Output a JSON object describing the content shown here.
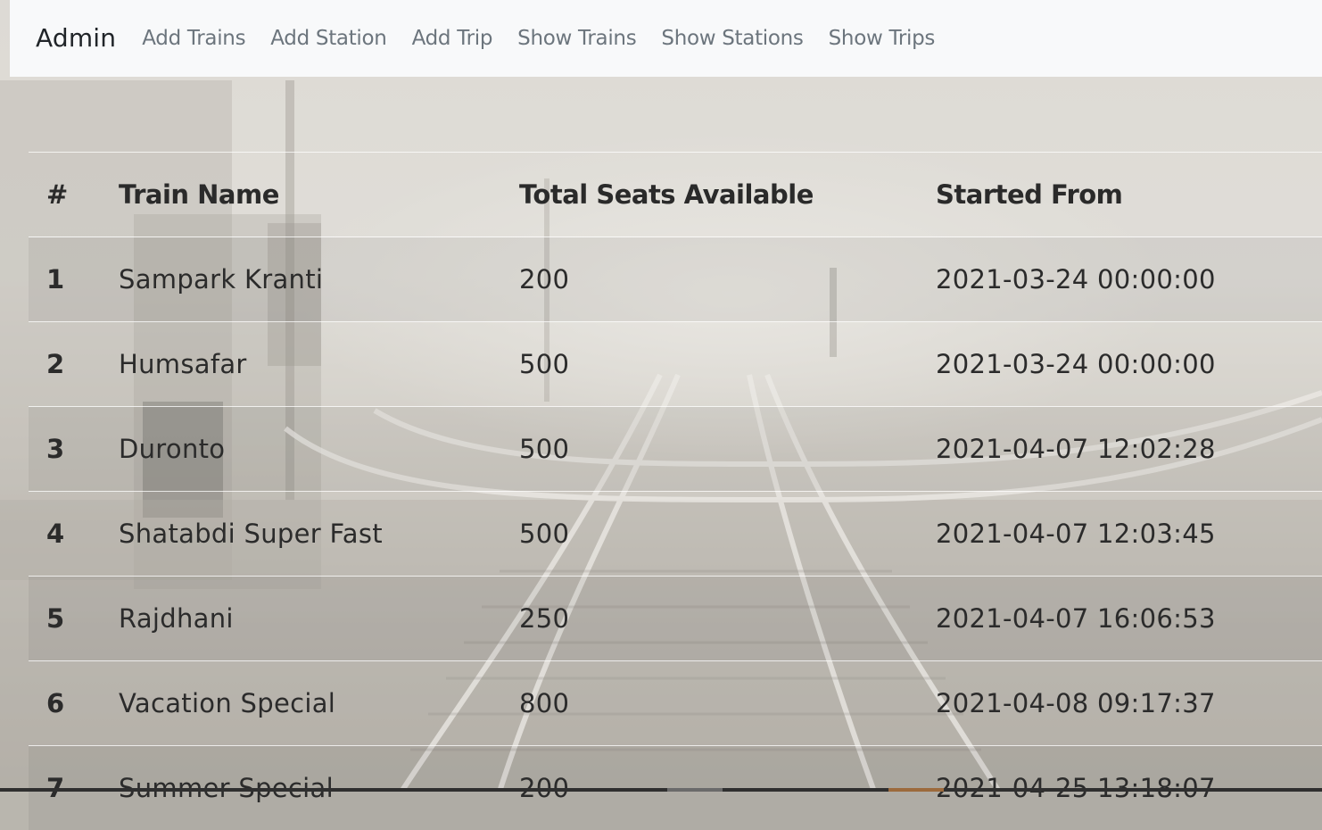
{
  "navbar": {
    "brand": "Admin",
    "links": [
      "Add Trains",
      "Add Station",
      "Add Trip",
      "Show Trains",
      "Show Stations",
      "Show Trips"
    ]
  },
  "table": {
    "headers": [
      "#",
      "Train Name",
      "Total Seats Available",
      "Started From"
    ],
    "rows": [
      [
        "1",
        "Sampark Kranti",
        "200",
        "2021-03-24 00:00:00"
      ],
      [
        "2",
        "Humsafar",
        "500",
        "2021-03-24 00:00:00"
      ],
      [
        "3",
        "Duronto",
        "500",
        "2021-04-07 12:02:28"
      ],
      [
        "4",
        "Shatabdi Super Fast",
        "500",
        "2021-04-07 12:03:45"
      ],
      [
        "5",
        "Rajdhani",
        "250",
        "2021-04-07 16:06:53"
      ],
      [
        "6",
        "Vacation Special",
        "800",
        "2021-04-08 09:17:37"
      ],
      [
        "7",
        "Summer Special",
        "200",
        "2021-04-25 13:18:07"
      ]
    ]
  }
}
